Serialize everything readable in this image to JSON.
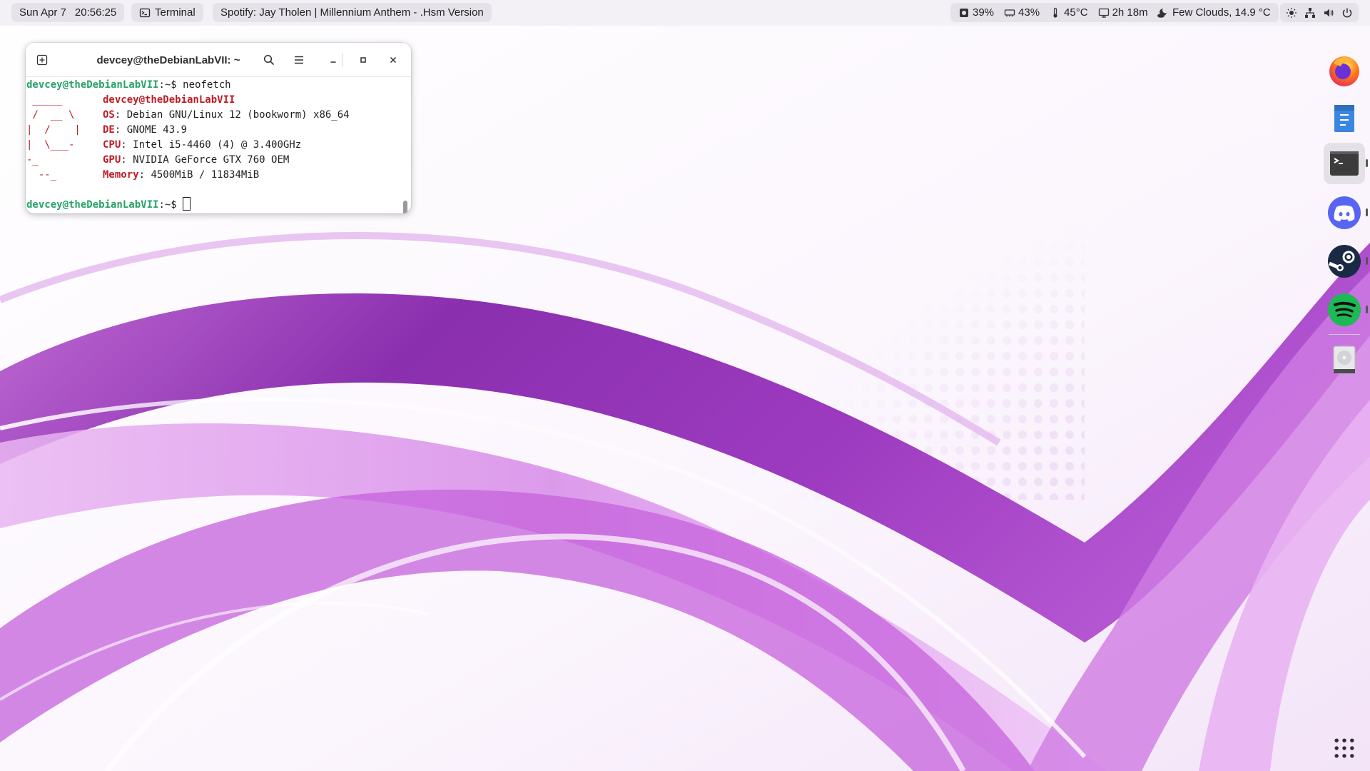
{
  "topbar": {
    "clock": {
      "date": "Sun Apr 7",
      "time": "20:56:25"
    },
    "terminal_app": {
      "label": "Terminal",
      "icon": "terminal-icon"
    },
    "media": {
      "label": "Spotify: Jay Tholen | Millennium Anthem - .Hsm Version"
    },
    "system_stats": {
      "disk": "39%",
      "memory": "43%",
      "temperature": "45°C",
      "uptime": "2h 18m"
    },
    "weather": {
      "label": "Few Clouds, 14.9 °C",
      "icon": "weather-night-cloud-icon"
    },
    "tray_icons": [
      "brightness-icon",
      "network-wired-icon",
      "volume-icon",
      "power-icon"
    ]
  },
  "terminal": {
    "title": "devcey@theDebianLabVII: ~",
    "prompt_user": "devcey@theDebianLabVII",
    "prompt_suffix": ":~$ ",
    "command": "neofetch",
    "ascii": [
      " _____",
      " /  __ \\",
      "|  /    |",
      "|  \\___-",
      "-_",
      "  --_"
    ],
    "info_header": "devcey@theDebianLabVII",
    "info": [
      {
        "key": "OS",
        "value": "Debian GNU/Linux 12 (bookworm) x86_64"
      },
      {
        "key": "DE",
        "value": "GNOME 43.9"
      },
      {
        "key": "CPU",
        "value": "Intel i5-4460 (4) @ 3.400GHz"
      },
      {
        "key": "GPU",
        "value": "NVIDIA GeForce GTX 760 OEM"
      },
      {
        "key": "Memory",
        "value": "4500MiB / 11834MiB"
      }
    ],
    "colon": ": "
  },
  "dock": {
    "items": [
      {
        "name": "firefox",
        "running": false
      },
      {
        "name": "text-editor",
        "running": false
      },
      {
        "name": "terminal",
        "running": true
      },
      {
        "name": "discord",
        "running": true
      },
      {
        "name": "steam",
        "running": true
      },
      {
        "name": "spotify",
        "running": true
      },
      {
        "name": "drive",
        "running": false
      }
    ]
  },
  "colors": {
    "prompt_green": "#26a269",
    "neofetch_red": "#c01c28",
    "topbar_bg": "#f4f1f6",
    "wallpaper_purple": "#9b3fc0"
  }
}
